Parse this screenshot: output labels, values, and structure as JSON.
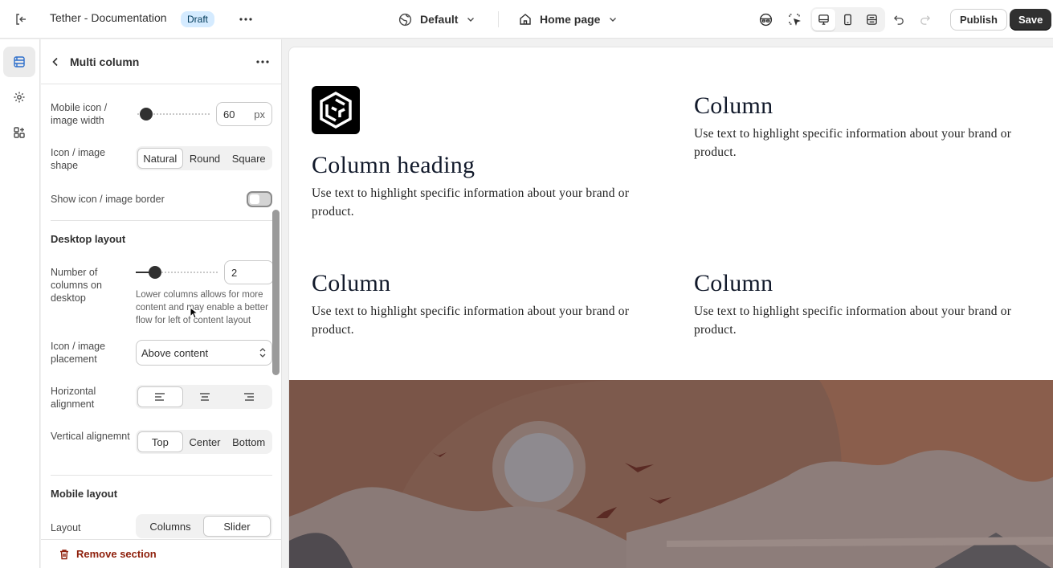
{
  "topbar": {
    "store_name": "Tether - Documentation",
    "status_badge": "Draft",
    "theme_selector": "Default",
    "page_selector": "Home page",
    "publish_label": "Publish",
    "save_label": "Save",
    "active_view": "desktop"
  },
  "rail": {
    "items": [
      {
        "icon": "sections-icon",
        "active": true
      },
      {
        "icon": "gear-icon",
        "active": false
      },
      {
        "icon": "apps-icon",
        "active": false
      }
    ]
  },
  "panel": {
    "title": "Multi column",
    "mobile_icon_width": {
      "label": "Mobile icon / image width",
      "value": "60",
      "unit": "px"
    },
    "icon_shape": {
      "label": "Icon / image shape",
      "options": [
        "Natural",
        "Round",
        "Square"
      ],
      "selected": "Natural"
    },
    "show_border": {
      "label": "Show icon / image border",
      "checked": false
    },
    "desktop_layout": {
      "title": "Desktop layout",
      "columns": {
        "label": "Number of columns on desktop",
        "value": "2",
        "help": "Lower columns allows for more content and may enable a better flow for left of content layout"
      },
      "placement": {
        "label": "Icon / image placement",
        "value": "Above content"
      },
      "horizontal_alignment": {
        "label": "Horizontal alignment",
        "selected": "left"
      },
      "vertical_alignment": {
        "label": "Vertical alignemnt",
        "options": [
          "Top",
          "Center",
          "Bottom"
        ],
        "selected": "Top"
      }
    },
    "mobile_layout": {
      "title": "Mobile layout",
      "layout": {
        "label": "Layout",
        "options": [
          "Columns",
          "Slider"
        ],
        "selected": "Slider"
      }
    },
    "remove_label": "Remove section"
  },
  "preview": {
    "columns": [
      {
        "heading": "Column heading",
        "text": "Use text to highlight specific information about your brand or product."
      },
      {
        "heading": "Column",
        "text": "Use text to highlight specific information about your brand or product."
      },
      {
        "heading": "Column",
        "text": "Use text to highlight specific information about your brand or product."
      },
      {
        "heading": "Column",
        "text": "Use text to highlight specific information about your brand or product."
      }
    ]
  }
}
